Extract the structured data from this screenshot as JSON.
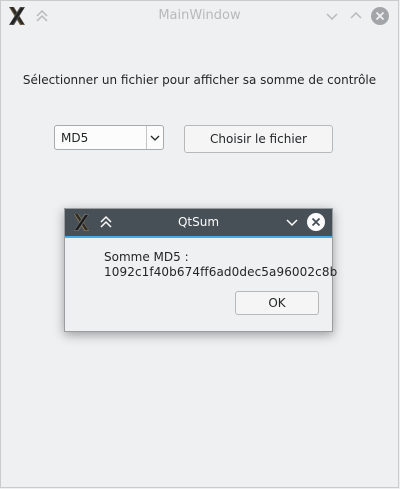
{
  "window": {
    "title": "MainWindow"
  },
  "main": {
    "instruction": "Sélectionner un fichier pour afficher sa somme de contrôle",
    "algorithm_select": {
      "selected": "MD5"
    },
    "choose_button": "Choisir le fichier"
  },
  "dialog": {
    "title": "QtSum",
    "message_line1": "Somme MD5 :",
    "message_line2": "1092c1f40b674ff6ad0dec5a96002c8b",
    "ok_button": "OK"
  },
  "colors": {
    "accent": "#3daee9",
    "dialog_titlebar": "#475057",
    "window_bg": "#eff0f1"
  },
  "icons": {
    "app_logo": "x-logo-icon",
    "keep_above": "double-chevron-up-icon",
    "minimize": "chevron-down-icon",
    "maximize": "chevron-up-icon",
    "close": "close-icon"
  }
}
